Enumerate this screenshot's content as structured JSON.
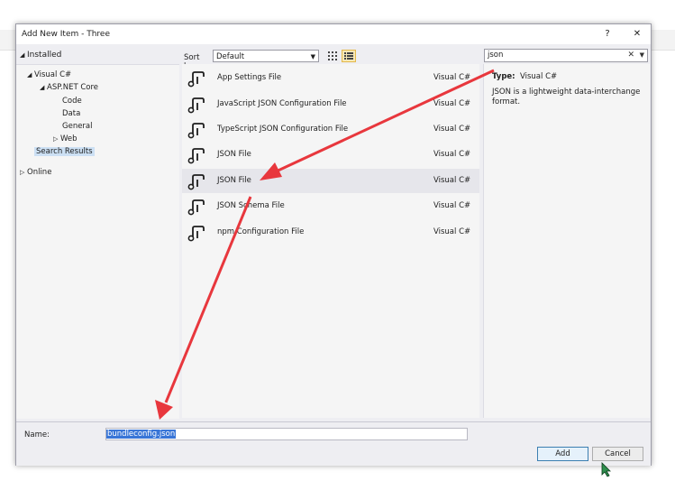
{
  "dialog": {
    "title": "Add New Item - Three",
    "help_glyph": "?",
    "close_glyph": "✕"
  },
  "left_panel": {
    "header": "Installed",
    "tree": [
      {
        "label": "Visual C#",
        "expander": "◢"
      },
      {
        "label": "ASP.NET Core",
        "expander": "◢"
      },
      {
        "label": "Code"
      },
      {
        "label": "Data"
      },
      {
        "label": "General"
      },
      {
        "label": "Web",
        "expander": "▷"
      },
      {
        "label": "Search Results",
        "selected": true
      },
      {
        "label": "Online",
        "expander": "▷"
      }
    ]
  },
  "toolbar": {
    "sort_label": "Sort by:",
    "sort_value": "Default",
    "view_buttons": [
      "grid-view-icon",
      "list-view-icon"
    ],
    "active_view": "list"
  },
  "search": {
    "value": "json",
    "clear_glyph": "✕"
  },
  "templates": [
    {
      "name": "App Settings File",
      "language": "Visual C#"
    },
    {
      "name": "JavaScript JSON Configuration File",
      "language": "Visual C#"
    },
    {
      "name": "TypeScript JSON Configuration File",
      "language": "Visual C#"
    },
    {
      "name": "JSON File",
      "language": "Visual C#"
    },
    {
      "name": "JSON File",
      "language": "Visual C#",
      "selected": true
    },
    {
      "name": "JSON Schema File",
      "language": "Visual C#"
    },
    {
      "name": "npm Configuration File",
      "language": "Visual C#"
    }
  ],
  "details": {
    "type_label": "Type:",
    "type_value": "Visual C#",
    "description": "JSON is a lightweight data-interchange format."
  },
  "bottom": {
    "name_label": "Name:",
    "name_value": "bundleconfig.json",
    "add_label": "Add",
    "cancel_label": "Cancel"
  },
  "colors": {
    "annotation_arrow": "#e8373d",
    "selection": "#3875d7"
  }
}
